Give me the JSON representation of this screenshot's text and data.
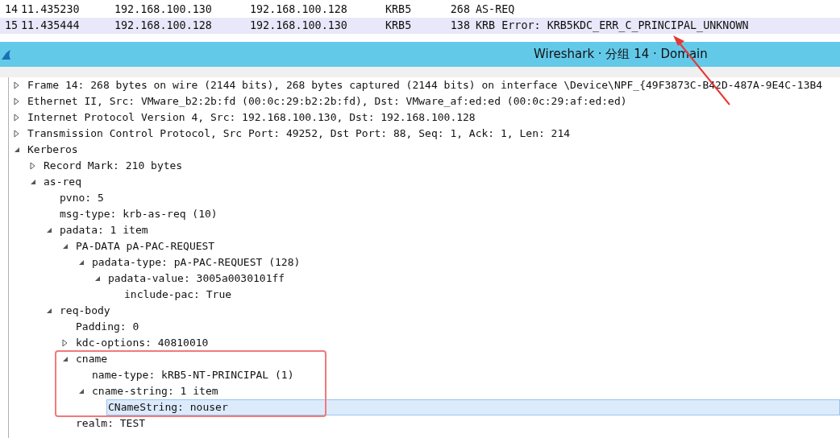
{
  "packets": [
    {
      "no": "14",
      "time": "11.435230",
      "source": "192.168.100.130",
      "destination": "192.168.100.128",
      "protocol": "KRB5",
      "length": "268",
      "info": "AS-REQ",
      "selected": false
    },
    {
      "no": "15",
      "time": "11.435444",
      "source": "192.168.100.128",
      "destination": "192.168.100.130",
      "protocol": "KRB5",
      "length": "138",
      "info": "KRB Error: KRB5KDC_ERR_C_PRINCIPAL_UNKNOWN",
      "selected": true
    }
  ],
  "window": {
    "title": "Wireshark · 分组 14 · Domain"
  },
  "tree": [
    {
      "label": "Frame 14: 268 bytes on wire (2144 bits), 268 bytes captured (2144 bits) on interface \\Device\\NPF_{49F3873C-B42D-487A-9E4C-13B4",
      "expanded": false,
      "selected": false
    },
    {
      "label": "Ethernet II, Src: VMware_b2:2b:fd (00:0c:29:b2:2b:fd), Dst: VMware_af:ed:ed (00:0c:29:af:ed:ed)",
      "expanded": false,
      "selected": false
    },
    {
      "label": "Internet Protocol Version 4, Src: 192.168.100.130, Dst: 192.168.100.128",
      "expanded": false,
      "selected": false
    },
    {
      "label": "Transmission Control Protocol, Src Port: 49252, Dst Port: 88, Seq: 1, Ack: 1, Len: 214",
      "expanded": false,
      "selected": false
    },
    {
      "label": "Kerberos",
      "expanded": true,
      "selected": false,
      "children": [
        {
          "label": "Record Mark: 210 bytes",
          "expanded": false,
          "selected": false
        },
        {
          "label": "as-req",
          "expanded": true,
          "selected": false,
          "children": [
            {
              "label": "pvno: 5",
              "selected": false
            },
            {
              "label": "msg-type: krb-as-req (10)",
              "selected": false
            },
            {
              "label": "padata: 1 item",
              "expanded": true,
              "selected": false,
              "children": [
                {
                  "label": "PA-DATA pA-PAC-REQUEST",
                  "expanded": true,
                  "selected": false,
                  "children": [
                    {
                      "label": "padata-type: pA-PAC-REQUEST (128)",
                      "expanded": true,
                      "selected": false,
                      "children": [
                        {
                          "label": "padata-value: 3005a0030101ff",
                          "expanded": true,
                          "selected": false,
                          "children": [
                            {
                              "label": "include-pac: True",
                              "selected": false
                            }
                          ]
                        }
                      ]
                    }
                  ]
                }
              ]
            },
            {
              "label": "req-body",
              "expanded": true,
              "selected": false,
              "children": [
                {
                  "label": "Padding: 0",
                  "selected": false
                },
                {
                  "label": "kdc-options: 40810010",
                  "expanded": false,
                  "selected": false
                },
                {
                  "label": "cname",
                  "expanded": true,
                  "selected": false,
                  "children": [
                    {
                      "label": "name-type: kRB5-NT-PRINCIPAL (1)",
                      "selected": false
                    },
                    {
                      "label": "cname-string: 1 item",
                      "expanded": true,
                      "selected": false,
                      "children": [
                        {
                          "label": "CNameString: nouser",
                          "selected": true
                        }
                      ]
                    }
                  ]
                },
                {
                  "label": "realm: TEST",
                  "selected": false
                }
              ]
            }
          ]
        }
      ]
    }
  ]
}
